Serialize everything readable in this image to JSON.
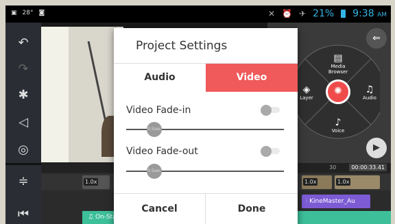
{
  "status_bar": {
    "left_icons": [
      "image-icon",
      "temperature-icon",
      "camera-icon"
    ],
    "temperature": "28°",
    "battery_percent": "21%",
    "time": "9:38",
    "ampm": "AM"
  },
  "left_toolbar": {
    "items": [
      "undo-icon",
      "redo-icon",
      "magic-wand-icon",
      "share-icon",
      "settings-icon",
      "split-icon",
      "skip-to-start-icon"
    ]
  },
  "wheel": {
    "media_browser_label": "Media Browser",
    "layer_label": "Layer",
    "audio_label": "Audio",
    "voice_label": "Voice"
  },
  "timeline": {
    "ruler_value": "30",
    "timecode": "00:00:33.41",
    "clip_speed_1": "1.0x",
    "clip_speed_2": "1.0x",
    "clip_speed_3": "1.0x",
    "audio_clip_label": "KineMaster_Au",
    "music_track_label": "On-Stage, Serene, Travel"
  },
  "dialog": {
    "title": "Project Settings",
    "tab_audio": "Audio",
    "tab_video": "Video",
    "fade_in_label": "Video Fade-in",
    "fade_out_label": "Video Fade-out",
    "fade_in_value": "0.5sec",
    "fade_out_value": "0.5sec",
    "cancel": "Cancel",
    "done": "Done"
  },
  "colors": {
    "accent_red": "#f05a5a",
    "status_blue": "#33b5e5",
    "audio_purple": "#7c5bd4",
    "music_teal": "#3dbf9a"
  }
}
